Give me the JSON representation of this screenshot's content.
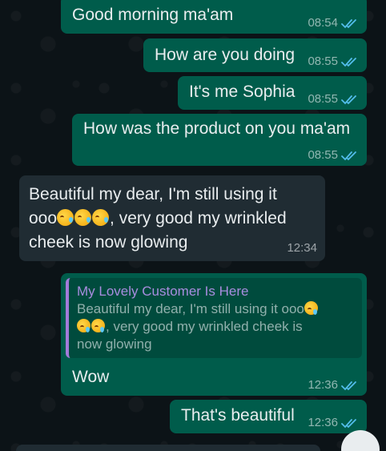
{
  "messages": [
    {
      "direction": "outgoing",
      "text": "Good morning ma'am",
      "time": "08:54",
      "status": "read"
    },
    {
      "direction": "outgoing",
      "text": "How are you doing",
      "time": "08:55",
      "status": "read"
    },
    {
      "direction": "outgoing",
      "text": "It's me Sophia",
      "time": "08:55",
      "status": "read"
    },
    {
      "direction": "outgoing",
      "text": "How was the product on you ma'am",
      "time": "08:55",
      "status": "read"
    },
    {
      "direction": "incoming",
      "line1": "Beautiful my dear, I'm still using it",
      "line2_prefix": "ooo",
      "emoji_count": 3,
      "emoji_name": "face-with-tears-of-joy",
      "line2_suffix": ", very good my wrinkled",
      "line3": "cheek is now glowing",
      "time": "12:34"
    },
    {
      "direction": "outgoing",
      "quote": {
        "author": "My Lovely Customer Is Here",
        "line1": "Beautiful my dear, I'm still using it ooo",
        "line2_suffix": ", very good my wrinkled cheek is",
        "line3": "now glowing"
      },
      "text": "Wow",
      "time": "12:36",
      "status": "read"
    },
    {
      "direction": "outgoing",
      "text": "That's beautiful",
      "time": "12:36",
      "status": "read"
    }
  ],
  "colors": {
    "outgoing_bubble": "#005c4b",
    "incoming_bubble": "#202c33",
    "read_tick": "#53bdeb",
    "quote_bar": "#a37bd9"
  }
}
